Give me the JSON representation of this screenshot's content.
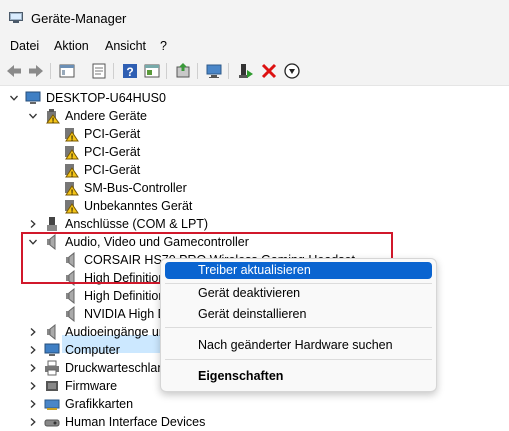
{
  "window": {
    "title": "Geräte-Manager"
  },
  "menu": [
    "Datei",
    "Aktion",
    "Ansicht",
    "?"
  ],
  "toolbar": [
    "back-icon",
    "forward-icon",
    "show-hide-tree-icon",
    "properties-icon",
    "help-icon",
    "view-icon",
    "update-driver-icon",
    "scan-hardware-icon",
    "enable-device-icon",
    "uninstall-icon",
    "download-icon"
  ],
  "tree": {
    "root": "DESKTOP-U64HUS0",
    "nodes": [
      "Andere Geräte",
      "PCI-Gerät",
      "PCI-Gerät",
      "PCI-Gerät",
      "SM-Bus-Controller",
      "Unbekanntes Gerät",
      "Anschlüsse (COM & LPT)",
      "Audio, Video und Gamecontroller",
      "CORSAIR HS70 PRO Wireless Gaming Headset",
      "High Definition Audio-Gerät",
      "High Definition Audio-Gerät",
      "NVIDIA High Definition Audio",
      "Audioeingänge und -ausgänge",
      "Computer",
      "Druckwarteschlangen",
      "Firmware",
      "Grafikkarten",
      "Human Interface Devices"
    ]
  },
  "context_menu": {
    "update_driver": "Treiber aktualisieren",
    "disable": "Gerät deaktivieren",
    "uninstall": "Gerät deinstallieren",
    "scan": "Nach geänderter Hardware suchen",
    "properties": "Eigenschaften"
  },
  "colors": {
    "accent": "#0a64d0",
    "selection": "#cce8ff",
    "annotation": "#d1182b"
  }
}
